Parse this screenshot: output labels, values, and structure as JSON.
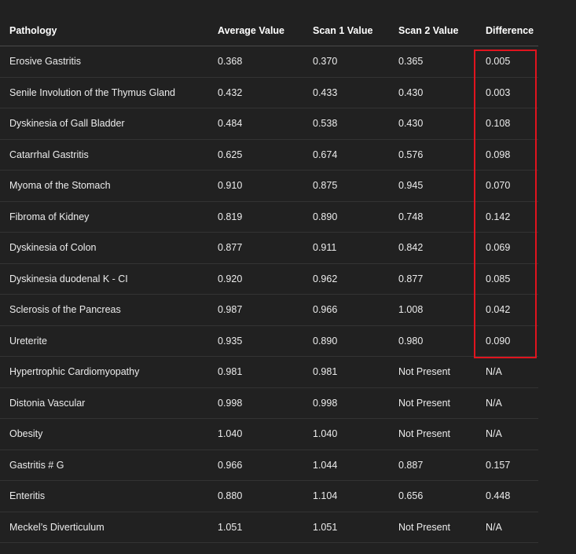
{
  "table": {
    "headers": [
      "Pathology",
      "Average Value",
      "Scan 1 Value",
      "Scan 2 Value",
      "Difference"
    ],
    "rows": [
      [
        "Erosive Gastritis",
        "0.368",
        "0.370",
        "0.365",
        "0.005"
      ],
      [
        "Senile Involution of the Thymus Gland",
        "0.432",
        "0.433",
        "0.430",
        "0.003"
      ],
      [
        "Dyskinesia of Gall Bladder",
        "0.484",
        "0.538",
        "0.430",
        "0.108"
      ],
      [
        "Catarrhal Gastritis",
        "0.625",
        "0.674",
        "0.576",
        "0.098"
      ],
      [
        "Myoma of the Stomach",
        "0.910",
        "0.875",
        "0.945",
        "0.070"
      ],
      [
        "Fibroma of Kidney",
        "0.819",
        "0.890",
        "0.748",
        "0.142"
      ],
      [
        "Dyskinesia of Colon",
        "0.877",
        "0.911",
        "0.842",
        "0.069"
      ],
      [
        "Dyskinesia duodenal K - CI",
        "0.920",
        "0.962",
        "0.877",
        "0.085"
      ],
      [
        "Sclerosis of the Pancreas",
        "0.987",
        "0.966",
        "1.008",
        "0.042"
      ],
      [
        "Ureterite",
        "0.935",
        "0.890",
        "0.980",
        "0.090"
      ],
      [
        "Hypertrophic Cardiomyopathy",
        "0.981",
        "0.981",
        "Not Present",
        "N/A"
      ],
      [
        "Distonia Vascular",
        "0.998",
        "0.998",
        "Not Present",
        "N/A"
      ],
      [
        "Obesity",
        "1.040",
        "1.040",
        "Not Present",
        "N/A"
      ],
      [
        "Gastritis # G",
        "0.966",
        "1.044",
        "0.887",
        "0.157"
      ],
      [
        "Enteritis",
        "0.880",
        "1.104",
        "0.656",
        "0.448"
      ],
      [
        "Meckel’s Diverticulum",
        "1.051",
        "1.051",
        "Not Present",
        "N/A"
      ]
    ]
  },
  "highlight": {
    "color": "#e0141e",
    "column": "Difference",
    "rows_from": 0,
    "rows_to": 9
  },
  "colors": {
    "background": "#212121",
    "text": "#ececec",
    "header_text": "#ffffff"
  }
}
